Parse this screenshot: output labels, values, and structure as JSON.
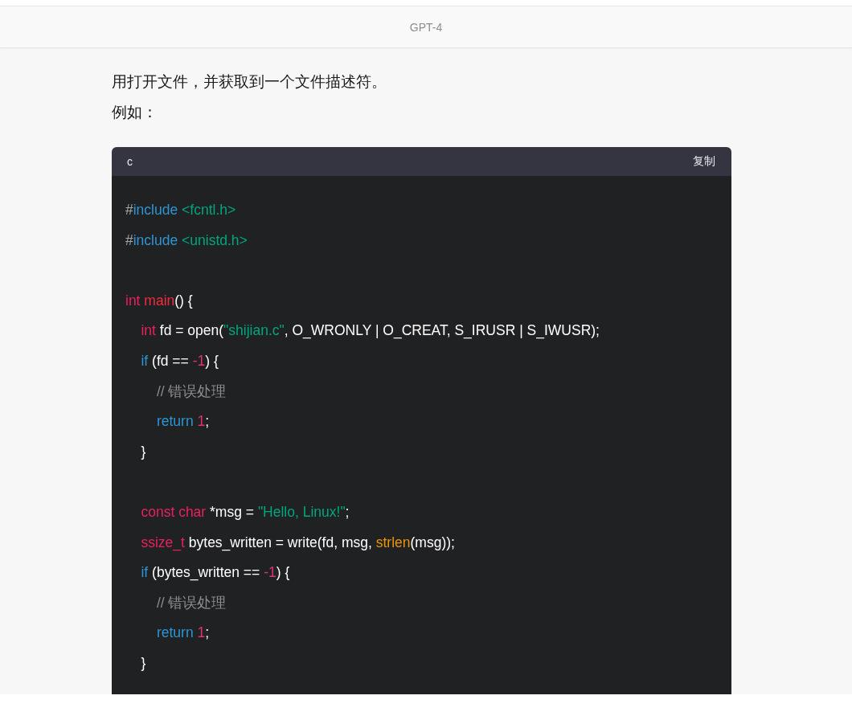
{
  "header": {
    "title": "GPT-4"
  },
  "message": {
    "paragraphs": [
      "用打开文件，并获取到一个文件描述符。",
      "例如："
    ],
    "code_block": {
      "language": "c",
      "copy_label": "复制",
      "lines": [
        {
          "kind": "code",
          "tokens": [
            {
              "kind": "pre",
              "text": "#"
            },
            {
              "kind": "kw",
              "text": "include"
            },
            {
              "kind": "str",
              "text": " <fcntl.h>"
            }
          ]
        },
        {
          "kind": "code",
          "tokens": [
            {
              "kind": "pre",
              "text": "#"
            },
            {
              "kind": "kw",
              "text": "include"
            },
            {
              "kind": "str",
              "text": " <unistd.h>"
            }
          ]
        },
        {
          "kind": "blank"
        },
        {
          "kind": "code",
          "tokens": [
            {
              "kind": "type",
              "text": "int"
            },
            {
              "kind": "fn",
              "text": " main"
            },
            {
              "kind": "plain",
              "text": "() {"
            }
          ]
        },
        {
          "kind": "code",
          "tokens": [
            {
              "kind": "type",
              "text": "    int"
            },
            {
              "kind": "plain",
              "text": " fd = open("
            },
            {
              "kind": "str",
              "text": "\"shijian.c\""
            },
            {
              "kind": "plain",
              "text": ", O_WRONLY | O_CREAT, S_IRUSR | S_IWUSR);"
            }
          ]
        },
        {
          "kind": "code",
          "tokens": [
            {
              "kind": "kw",
              "text": "    if"
            },
            {
              "kind": "plain",
              "text": " (fd == "
            },
            {
              "kind": "num",
              "text": "-1"
            },
            {
              "kind": "plain",
              "text": ") {"
            }
          ]
        },
        {
          "kind": "code",
          "tokens": [
            {
              "kind": "com",
              "text": "        // 错误处理"
            }
          ]
        },
        {
          "kind": "code",
          "tokens": [
            {
              "kind": "kw",
              "text": "        return"
            },
            {
              "kind": "num",
              "text": " 1"
            },
            {
              "kind": "plain",
              "text": ";"
            }
          ]
        },
        {
          "kind": "code",
          "tokens": [
            {
              "kind": "plain",
              "text": "    }"
            }
          ]
        },
        {
          "kind": "blank"
        },
        {
          "kind": "code",
          "tokens": [
            {
              "kind": "type",
              "text": "    const char"
            },
            {
              "kind": "plain",
              "text": " *msg = "
            },
            {
              "kind": "str",
              "text": "\"Hello, Linux!\""
            },
            {
              "kind": "plain",
              "text": ";"
            }
          ]
        },
        {
          "kind": "code",
          "tokens": [
            {
              "kind": "type",
              "text": "    ssize_t"
            },
            {
              "kind": "plain",
              "text": " bytes_written = write(fd, msg, "
            },
            {
              "kind": "builtin",
              "text": "strlen"
            },
            {
              "kind": "plain",
              "text": "(msg));"
            }
          ]
        },
        {
          "kind": "code",
          "tokens": [
            {
              "kind": "kw",
              "text": "    if"
            },
            {
              "kind": "plain",
              "text": " (bytes_written == "
            },
            {
              "kind": "num",
              "text": "-1"
            },
            {
              "kind": "plain",
              "text": ") {"
            }
          ]
        },
        {
          "kind": "code",
          "tokens": [
            {
              "kind": "com",
              "text": "        // 错误处理"
            }
          ]
        },
        {
          "kind": "code",
          "tokens": [
            {
              "kind": "kw",
              "text": "        return"
            },
            {
              "kind": "num",
              "text": " 1"
            },
            {
              "kind": "plain",
              "text": ";"
            }
          ]
        },
        {
          "kind": "code",
          "tokens": [
            {
              "kind": "plain",
              "text": "    }"
            }
          ]
        }
      ]
    }
  }
}
